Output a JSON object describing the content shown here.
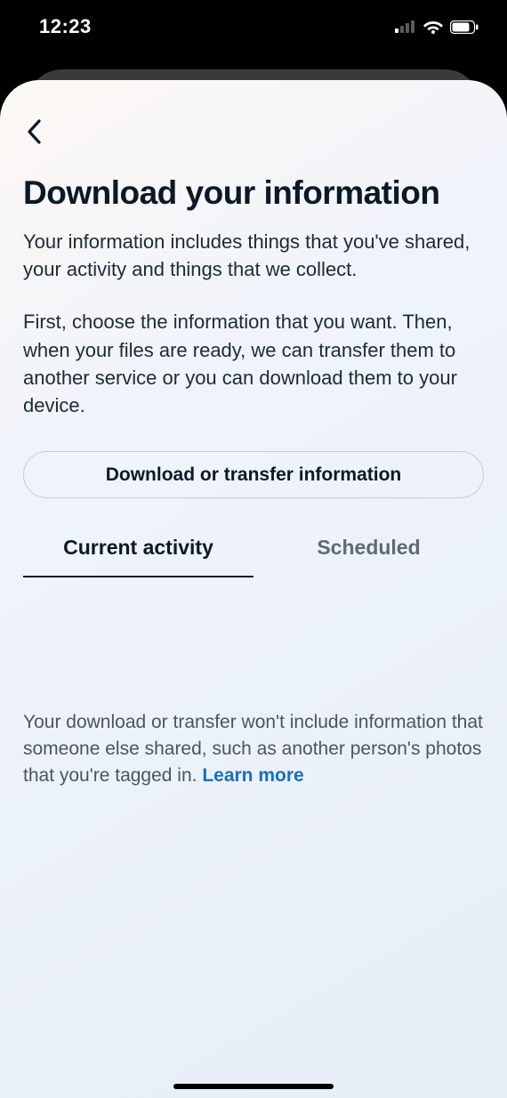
{
  "statusBar": {
    "time": "12:23"
  },
  "page": {
    "title": "Download your information",
    "paragraph1": "Your information includes things that you've shared, your activity and things that we collect.",
    "paragraph2": "First, choose the information that you want. Then, when your files are ready, we can transfer them to another service or you can download them to your device.",
    "primaryButtonLabel": "Download or transfer information"
  },
  "tabs": {
    "items": [
      {
        "label": "Current activity",
        "active": true
      },
      {
        "label": "Scheduled",
        "active": false
      }
    ]
  },
  "note": {
    "text": "Your download or transfer won't include information that someone else shared, such as another person's photos that you're tagged in. ",
    "linkLabel": "Learn more"
  }
}
